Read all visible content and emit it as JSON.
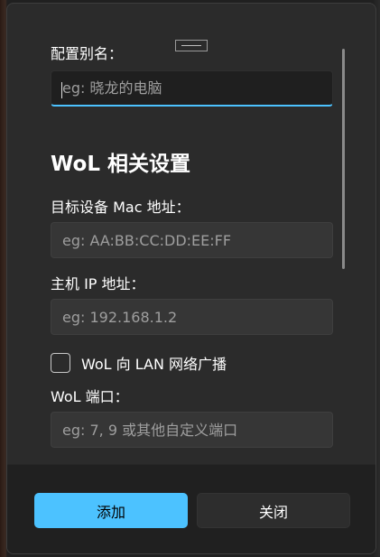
{
  "alias": {
    "label": "配置别名：",
    "placeholder": "eg: 晓龙的电脑"
  },
  "wol_section": {
    "title": "WoL 相关设置"
  },
  "mac": {
    "label": "目标设备 Mac 地址：",
    "placeholder": "eg: AA:BB:CC:DD:EE:FF"
  },
  "host_ip": {
    "label": "主机 IP 地址：",
    "placeholder": "eg: 192.168.1.2"
  },
  "broadcast": {
    "label": "WoL 向 LAN 网络广播",
    "checked": false
  },
  "port": {
    "label": "WoL 端口：",
    "placeholder": "eg: 7, 9 或其他自定义端口"
  },
  "footer": {
    "add_label": "添加",
    "close_label": "关闭"
  },
  "colors": {
    "accent": "#4cc2ff",
    "dialog_bg": "#2b2b2b",
    "footer_bg": "#202020"
  }
}
